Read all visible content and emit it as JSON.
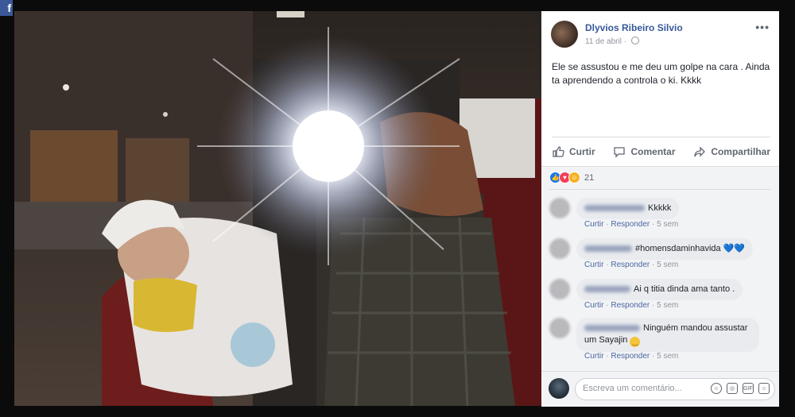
{
  "post": {
    "author": "Dlyvios Ribeiro Silvio",
    "date": "11 de abril",
    "more": "•••",
    "text": "Ele se assustou e me deu um golpe na cara . Ainda ta aprendendo a controla o ki. Kkkk"
  },
  "actions": {
    "like": "Curtir",
    "comment": "Comentar",
    "share": "Compartilhar"
  },
  "reactions": {
    "count": "21",
    "colors": {
      "like": "#1877f2",
      "love": "#f33e58",
      "haha": "#f7b125"
    }
  },
  "comments": [
    {
      "text": "Kkkkk",
      "reply_like": "Curtir",
      "reply": "Responder",
      "time": "5 sem"
    },
    {
      "text": "#homensdaminhavida",
      "emoji": "💙💙",
      "reply_like": "Curtir",
      "reply": "Responder",
      "time": "5 sem"
    },
    {
      "text": "Ai q titia dinda ama tanto .",
      "reply_like": "Curtir",
      "reply": "Responder",
      "time": "5 sem"
    },
    {
      "text_line1": "Ninguém mandou assustar",
      "text_line2": "um Sayajin",
      "emoji": "😊",
      "reply_like": "Curtir",
      "reply": "Responder",
      "time": "5 sem"
    }
  ],
  "composer": {
    "placeholder": "Escreva um comentário..."
  },
  "colors": {
    "link": "#365899",
    "muted": "#90949c",
    "action": "#606770"
  }
}
